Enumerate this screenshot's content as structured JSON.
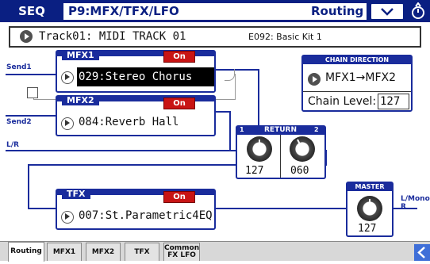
{
  "header": {
    "mode": "SEQ",
    "page": "P9:MFX/TFX/LFO",
    "tab": "Routing"
  },
  "program": {
    "track": "Track01: MIDI TRACK 01",
    "kit": "E092: Basic Kit 1"
  },
  "labels": {
    "send1": "Send1",
    "send2": "Send2",
    "lr": "L/R",
    "lmono": "L/Mono",
    "r": "R"
  },
  "mfx1": {
    "title": "MFX1",
    "on": "On",
    "effect": "029:Stereo Chorus"
  },
  "mfx2": {
    "title": "MFX2",
    "on": "On",
    "effect": "084:Reverb Hall"
  },
  "chain": {
    "title": "CHAIN DIRECTION",
    "direction": "MFX1→MFX2",
    "level_label": "Chain Level:",
    "level_value": "127"
  },
  "return": {
    "title": "RETURN",
    "ch1": "1",
    "ch2": "2",
    "value1": "127",
    "value2": "060"
  },
  "tfx": {
    "title": "TFX",
    "on": "On",
    "effect": "007:St.Parametric4EQ"
  },
  "master": {
    "title": "MASTER",
    "value": "127"
  },
  "tabs": [
    "Routing",
    "MFX1",
    "MFX2",
    "TFX",
    "Common FX LFO"
  ],
  "colors": {
    "header": "#0a1f82",
    "accent": "#1a2c9c",
    "on_button": "#c81414",
    "active_tab": "#ffffff"
  }
}
